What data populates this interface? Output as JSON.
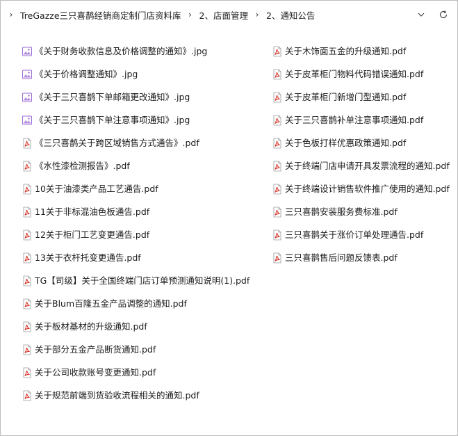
{
  "breadcrumb": {
    "items": [
      "TreGazze三只喜鹊经销商定制门店资料库",
      "2、店面管理",
      "2、通知公告"
    ]
  },
  "controls": {
    "dropdown_icon": "chevron-down-icon",
    "refresh_icon": "refresh-icon"
  },
  "files": {
    "left": [
      {
        "name": "《关于财务收款信息及价格调整的通知》.jpg",
        "type": "jpg"
      },
      {
        "name": "《关于价格调整通知》.jpg",
        "type": "jpg"
      },
      {
        "name": "《关于三只喜鹊下单邮箱更改通知》.jpg",
        "type": "jpg"
      },
      {
        "name": "《关于三只喜鹊下单注意事项通知》.jpg",
        "type": "jpg"
      },
      {
        "name": "《三只喜鹊关于跨区域销售方式通告》.pdf",
        "type": "pdf"
      },
      {
        "name": "《水性漆检测报告》.pdf",
        "type": "pdf"
      },
      {
        "name": "10关于油漆类产品工艺通告.pdf",
        "type": "pdf"
      },
      {
        "name": "11关于非标混油色板通告.pdf",
        "type": "pdf"
      },
      {
        "name": "12关于柜门工艺变更通告.pdf",
        "type": "pdf"
      },
      {
        "name": "13关于衣杆托变更通告.pdf",
        "type": "pdf"
      },
      {
        "name": "TG【司级】关于全国终端门店订单预测通知说明(1).pdf",
        "type": "pdf"
      },
      {
        "name": "关于Blum百隆五金产品调整的通知.pdf",
        "type": "pdf"
      },
      {
        "name": "关于板材基材的升级通知.pdf",
        "type": "pdf"
      },
      {
        "name": "关于部分五金产品断货通知.pdf",
        "type": "pdf"
      },
      {
        "name": "关于公司收款账号变更通知.pdf",
        "type": "pdf"
      },
      {
        "name": "关于规范前端到货验收流程相关的通知.pdf",
        "type": "pdf"
      }
    ],
    "right": [
      {
        "name": "关于木饰面五金的升级通知.pdf",
        "type": "pdf"
      },
      {
        "name": "关于皮革柜门物料代码错误通知.pdf",
        "type": "pdf"
      },
      {
        "name": "关于皮革柜门新增门型通知.pdf",
        "type": "pdf"
      },
      {
        "name": "关于三只喜鹊补单注意事项通知.pdf",
        "type": "pdf"
      },
      {
        "name": "关于色板打样优惠政策通知.pdf",
        "type": "pdf"
      },
      {
        "name": "关于终端门店申请开具发票流程的通知.pdf",
        "type": "pdf"
      },
      {
        "name": "关于终端设计销售软件推广使用的通知.pdf",
        "type": "pdf"
      },
      {
        "name": "三只喜鹊安装服务费标准.pdf",
        "type": "pdf"
      },
      {
        "name": "三只喜鹊关于涨价订单处理通告.pdf",
        "type": "pdf"
      },
      {
        "name": "三只喜鹊售后问题反馈表.pdf",
        "type": "pdf"
      }
    ]
  },
  "colors": {
    "pdf_icon": "#d9342b",
    "image_icon": "#9b6bd6",
    "hover": "#e5f1fb"
  }
}
